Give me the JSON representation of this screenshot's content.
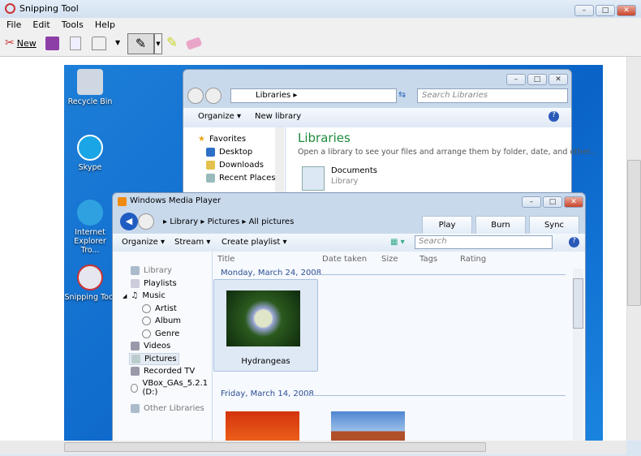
{
  "app": {
    "title": "Snipping Tool",
    "menu": [
      "File",
      "Edit",
      "Tools",
      "Help"
    ],
    "toolbar": {
      "new_label": "New"
    }
  },
  "desktop": {
    "icons": [
      "Recycle Bin",
      "Skype",
      "Internet Explorer Tro...",
      "Snipping Tool"
    ]
  },
  "explorer": {
    "breadcrumb": "Libraries",
    "search_placeholder": "Search Libraries",
    "organize": "Organize",
    "new_library": "New library",
    "nav": [
      "Favorites",
      "Desktop",
      "Downloads",
      "Recent Places"
    ],
    "heading": "Libraries",
    "subheading": "Open a library to see your files and arrange them by folder, date, and other...",
    "item_name": "Documents",
    "item_type": "Library"
  },
  "wmp": {
    "title": "Windows Media Player",
    "breadcrumb": [
      "Library",
      "Pictures",
      "All pictures"
    ],
    "tabs": [
      "Play",
      "Burn",
      "Sync"
    ],
    "toolbar": [
      "Organize",
      "Stream",
      "Create playlist"
    ],
    "search_placeholder": "Search",
    "columns": [
      "Title",
      "Date taken",
      "Size",
      "Tags",
      "Rating"
    ],
    "nav": [
      "Library",
      "Playlists",
      "Music",
      "Artist",
      "Album",
      "Genre",
      "Videos",
      "Pictures",
      "Recorded TV",
      "VBox_GAs_5.2.1 (D:)",
      "Other Libraries"
    ],
    "groups": [
      {
        "date": "Monday, March 24, 2008",
        "items": [
          "Hydrangeas"
        ]
      },
      {
        "date": "Friday, March 14, 2008"
      }
    ]
  }
}
